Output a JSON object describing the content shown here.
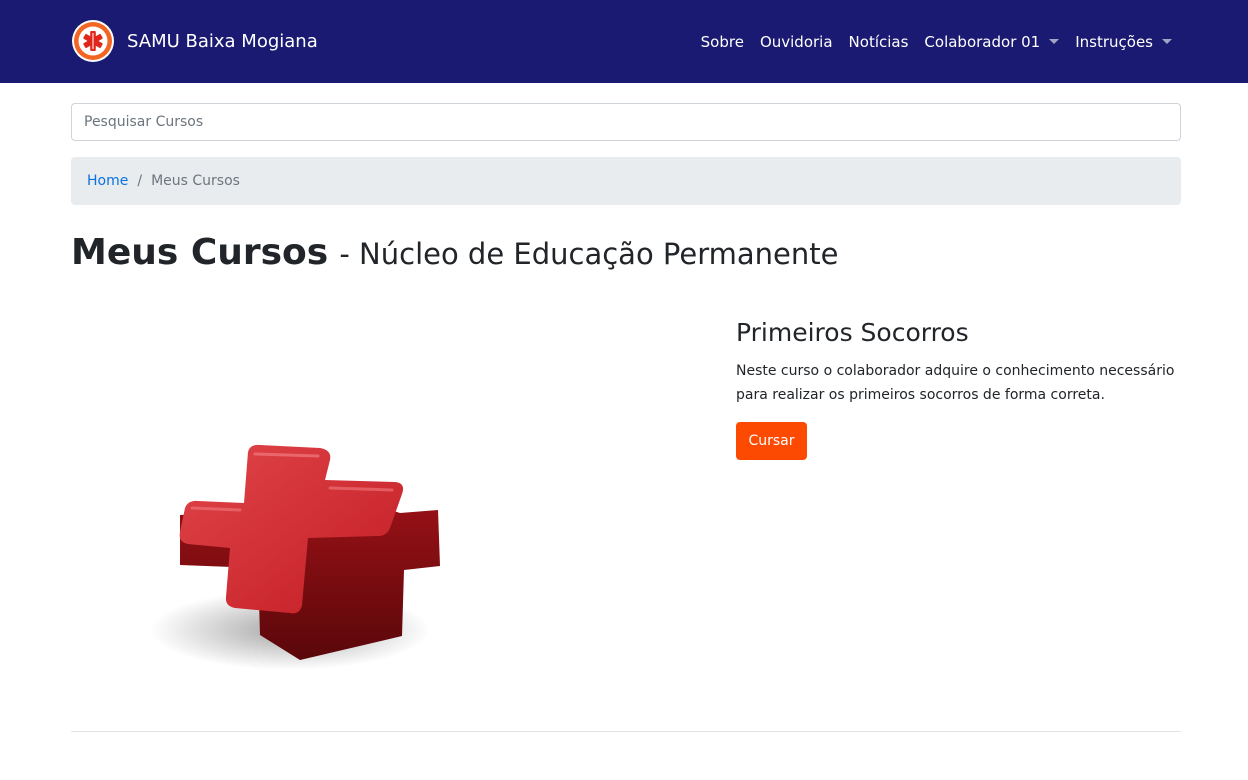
{
  "navbar": {
    "brand": "SAMU Baixa Mogiana",
    "logo_icon": "samu-star-of-life-logo",
    "items": [
      {
        "label": "Sobre",
        "dropdown": false
      },
      {
        "label": "Ouvidoria",
        "dropdown": false
      },
      {
        "label": "Notícias",
        "dropdown": false
      },
      {
        "label": "Colaborador 01",
        "dropdown": true
      },
      {
        "label": "Instruções",
        "dropdown": true
      }
    ],
    "background": "#1a1a72"
  },
  "search": {
    "placeholder": "Pesquisar Cursos",
    "value": ""
  },
  "breadcrumb": {
    "home": "Home",
    "current": "Meus Cursos"
  },
  "page": {
    "title": "Meus Cursos",
    "subtitle": "- Núcleo de Educação Permanente"
  },
  "course": {
    "image_icon": "red-cross-icon",
    "title": "Primeiros Socorros",
    "description": "Neste curso o colaborador adquire o conhecimento necessário para realizar os primeiros socorros de forma correta.",
    "button_label": "Cursar",
    "button_color": "#fd4a02"
  }
}
